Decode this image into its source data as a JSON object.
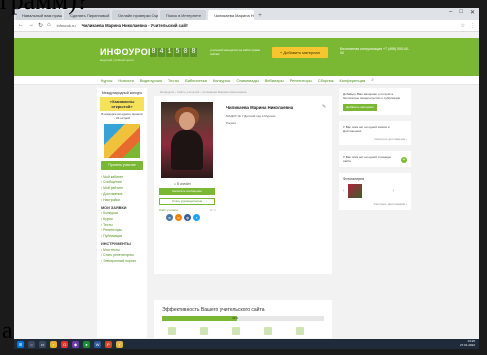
{
  "overlay": {
    "top_text": "грамм)?",
    "bottom_letter": "а"
  },
  "browser": {
    "tabs": [
      {
        "label": "Навальный вам пришел"
      },
      {
        "label": "Сделать Пиринговый код"
      },
      {
        "label": "Онлайн проверки Оценка"
      },
      {
        "label": "Поиск в Интернете"
      },
      {
        "label": "Чиликаева Марина Никола"
      }
    ],
    "new_tab": "+",
    "window_controls": [
      "–",
      "□",
      "✕"
    ],
    "nav": {
      "back": "←",
      "forward": "→",
      "reload": "↻",
      "home": "⌂"
    },
    "url": "infourok.ru",
    "page_title": "Чиликаева Марина Николаевна - Учительский сайт"
  },
  "header": {
    "logo": "ИНФОУРОК",
    "logo_sub": "ведущий учебный центр",
    "counter": [
      "8",
      "4",
      "1",
      "5",
      "0",
      "8"
    ],
    "counter_note": "учителей находятся на сайте прямо сейчас",
    "add_button": "+ Добавить материал",
    "right_text": "Бесплатная консультация +7 (495) 000-00-00"
  },
  "nav": {
    "items": [
      "Курсы",
      "Новости",
      "Видеоуроки",
      "Тесты",
      "Библиотека",
      "Конкурсы",
      "Олимпиады",
      "Вебинары",
      "Репетиторы",
      "Сборник",
      "Конференция"
    ],
    "search_icon": "⌕"
  },
  "left": {
    "promo_title": "Международный конкурс",
    "promo_name": "«Хаазамоны открытой»",
    "promo_gift": "В конкурсе ни одного прошли - 24 острой",
    "promo_button": "Принять участие",
    "menu": [
      "Мой кабинет",
      "Сообщения",
      "Мой рейтинг",
      "Достижения",
      "Настройки"
    ],
    "section1": "МОИ ЗАЯВКИ",
    "menu2": [
      "Конкурсы",
      "Курсы",
      "Тесты",
      "Репетиторы",
      "Публикации"
    ],
    "section2": "ИНСТРУМЕНТЫ",
    "menu3": [
      "Мои тесты",
      "Стать репетитором",
      "Электронный портал"
    ]
  },
  "main": {
    "breadcrumb": "Инфоурок › Сайты учителей › Чиликаева Марина Николаевна",
    "name": "Чиликаева Марина Николаевна",
    "edit_icon": "✎",
    "school": "МАДОУ № 7 Детский сад в Муроме",
    "country": "Россия",
    "online": "В онлайн",
    "btn_message": "Написать сообщение",
    "btn_subscribe": "Стать руководителем",
    "social_label": "Сайт учителя",
    "social_count": "0 / 1",
    "socials": [
      "в",
      "о",
      "ф",
      "т"
    ],
    "effectiveness_title": "Эффективность Вашего учительского сайта",
    "effectiveness_percent": "46%"
  },
  "right": {
    "box1_text": "Добавьте Ваш материал и получите бесплатное свидетельство о публикации",
    "box1_button": "Добавить материал",
    "box2_text": "У Вас пока нет ни одной записи в Достижениях",
    "box2_link": "Смотреть достижения ›",
    "box3_text": "У Вас пока нет ни одной страницы сайта",
    "box3_plus": "+",
    "gallery_title": "Фотогалерея",
    "gallery_link": "Смотреть фотографии ›"
  },
  "taskbar": {
    "time": "13:20",
    "date": "27.01.2022"
  },
  "colors": {
    "brand_green": "#7ab833",
    "accent_yellow": "#f6c52f"
  }
}
